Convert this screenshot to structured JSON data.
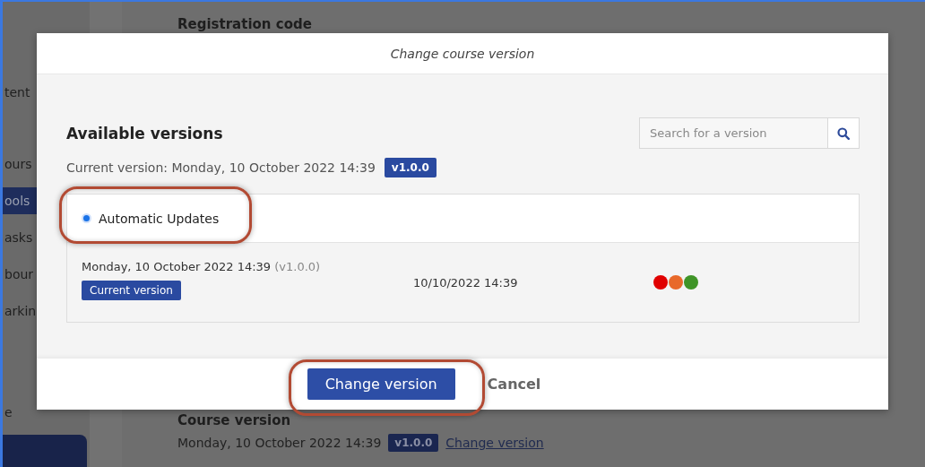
{
  "background": {
    "sidebar_items": [
      {
        "label": "tent",
        "selected": false
      },
      {
        "label": "ours",
        "selected": false
      },
      {
        "label": "ools",
        "selected": true
      },
      {
        "label": "asks",
        "selected": false
      },
      {
        "label": "bour",
        "selected": false
      },
      {
        "label": "arkin",
        "selected": false
      },
      {
        "label": "e",
        "selected": false
      }
    ],
    "registration_heading": "Registration code",
    "course_version_heading": "Course version",
    "course_version": {
      "date": "Monday, 10 October 2022 14:39",
      "badge": "v1.0.0",
      "link": "Change version"
    }
  },
  "dialog": {
    "title": "Change course version",
    "heading": "Available versions",
    "search": {
      "placeholder": "Search for a version"
    },
    "current_version": {
      "label": "Current version: Monday, 10 October 2022 14:39",
      "badge": "v1.0.0"
    },
    "automatic_updates": {
      "label": "Automatic Updates",
      "selected": true,
      "highlighted": true
    },
    "versions": [
      {
        "date": "Monday, 10 October 2022 14:39",
        "version": "(v1.0.0)",
        "tag": "Current version",
        "timestamp": "10/10/2022 14:39",
        "dots": [
          {
            "color": "#e00000"
          },
          {
            "color": "#e8692a"
          },
          {
            "color": "#3f9427"
          }
        ]
      }
    ],
    "buttons": [
      {
        "label": "Change version",
        "kind": "primary",
        "highlighted": true
      },
      {
        "label": "Cancel",
        "kind": "secondary",
        "highlighted": false
      }
    ]
  }
}
